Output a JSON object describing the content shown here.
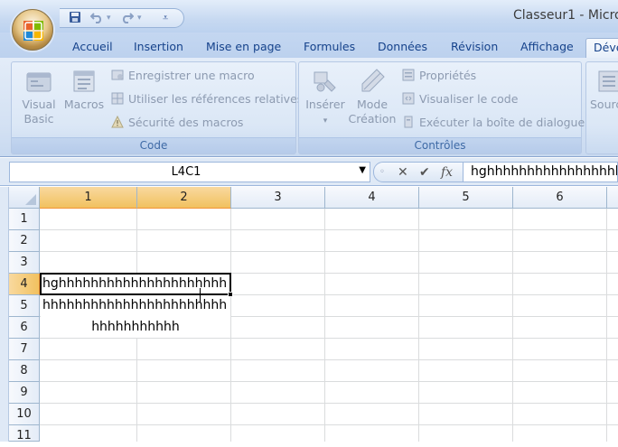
{
  "window": {
    "title": "Classeur1 - Micro"
  },
  "qat": {
    "save_icon": "save-icon",
    "undo_icon": "undo-icon",
    "redo_icon": "redo-icon",
    "customize_icon": "customize-qat-icon"
  },
  "tabs": [
    {
      "label": "Accueil"
    },
    {
      "label": "Insertion"
    },
    {
      "label": "Mise en page"
    },
    {
      "label": "Formules"
    },
    {
      "label": "Données"
    },
    {
      "label": "Révision"
    },
    {
      "label": "Affichage"
    },
    {
      "label": "Déve"
    }
  ],
  "ribbon": {
    "code": {
      "label": "Code",
      "visual_basic_1": "Visual",
      "visual_basic_2": "Basic",
      "macros": "Macros",
      "record_macro": "Enregistrer une macro",
      "relative_refs": "Utiliser les références relatives",
      "macro_security": "Sécurité des macros"
    },
    "controls": {
      "label": "Contrôles",
      "insert": "Insérer",
      "design_mode_1": "Mode",
      "design_mode_2": "Création",
      "properties": "Propriétés",
      "view_code": "Visualiser le code",
      "run_dialog": "Exécuter la boîte de dialogue"
    },
    "xml": {
      "source": "Sourc"
    }
  },
  "formula_bar": {
    "name_box": "L4C1",
    "fx_label": "fx",
    "content": "hghhhhhhhhhhhhhhhhh"
  },
  "grid": {
    "columns": [
      "1",
      "2",
      "3",
      "4",
      "5",
      "6"
    ],
    "rows": [
      "1",
      "2",
      "3",
      "4",
      "5",
      "6",
      "7",
      "8",
      "9",
      "10",
      "11"
    ],
    "selected_row": "4",
    "cells": {
      "r4": "hghhhhhhhhhhhhhhhhhhhhh",
      "r5": "hhhhhhhhhhhhhhhhhhhhhhh",
      "r6": "hhhhhhhhhhh"
    }
  }
}
